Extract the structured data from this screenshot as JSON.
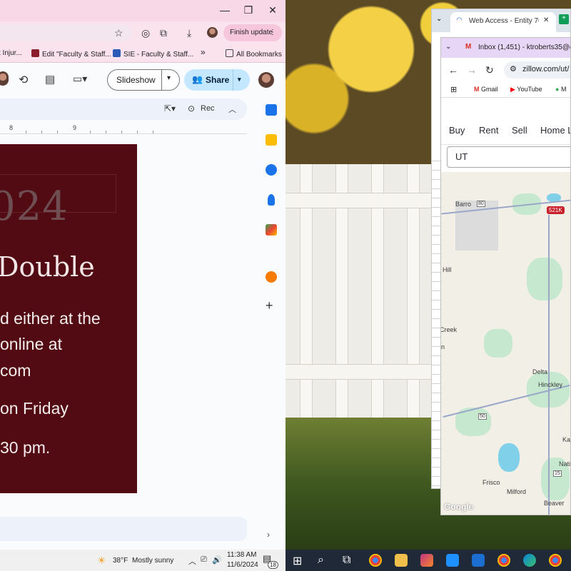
{
  "slides_window": {
    "controls": {
      "minimize": "—",
      "restore": "❐",
      "close": "✕"
    },
    "finish_update_label": "Finish update",
    "bookmarks": [
      {
        "label": "t Injur..."
      },
      {
        "label": "Edit \"Faculty & Staff..."
      },
      {
        "label": "SIE - Faculty & Staff..."
      },
      {
        "label": "»"
      },
      {
        "label": "All Bookmarks"
      }
    ],
    "slideshow_label": "Slideshow",
    "share_label": "Share",
    "rec_label": "Rec",
    "ruler": {
      "left": "8",
      "right": "9"
    },
    "slide": {
      "year": "024",
      "heading": "Double",
      "lines": [
        "d either at the",
        "online at",
        "com",
        "on Friday",
        "30 pm."
      ]
    }
  },
  "sheets_window": {
    "tab_title": "Web Access - Entity 70"
  },
  "zillow_window": {
    "tab_title": "Inbox (1,451) - ktroberts35@gm",
    "url": "zillow.com/ut/",
    "bookmarks": [
      "Gmail",
      "YouTube",
      "M"
    ],
    "nav": [
      "Buy",
      "Rent",
      "Sell",
      "Home L"
    ],
    "search_value": "UT",
    "map_labels": {
      "barro": "Barro",
      "hill": "Hill",
      "creek": "Creek",
      "n": "n",
      "delta": "Delta",
      "hinckley": "Hinckley",
      "frisco": "Frisco",
      "milford": "Milford",
      "beaver": "Beaver",
      "nati": "Nati",
      "kar": "Kar",
      "price_tag": "521K",
      "google": "Google",
      "shield_80": "80",
      "shield_50": "50",
      "shield_15": "15"
    }
  },
  "taskbar": {
    "weather_temp": "38°F",
    "weather_desc": "Mostly sunny",
    "time": "11:38 AM",
    "date": "11/6/2024",
    "notification_count": "18"
  },
  "colors": {
    "slide_bg": "#520b13",
    "share_bg": "#c2e7ff",
    "finish_update_bg": "#f6c6dc",
    "chrome_pink": "#f8d7e6",
    "zillow_tab_purple": "#e8d6f7"
  }
}
